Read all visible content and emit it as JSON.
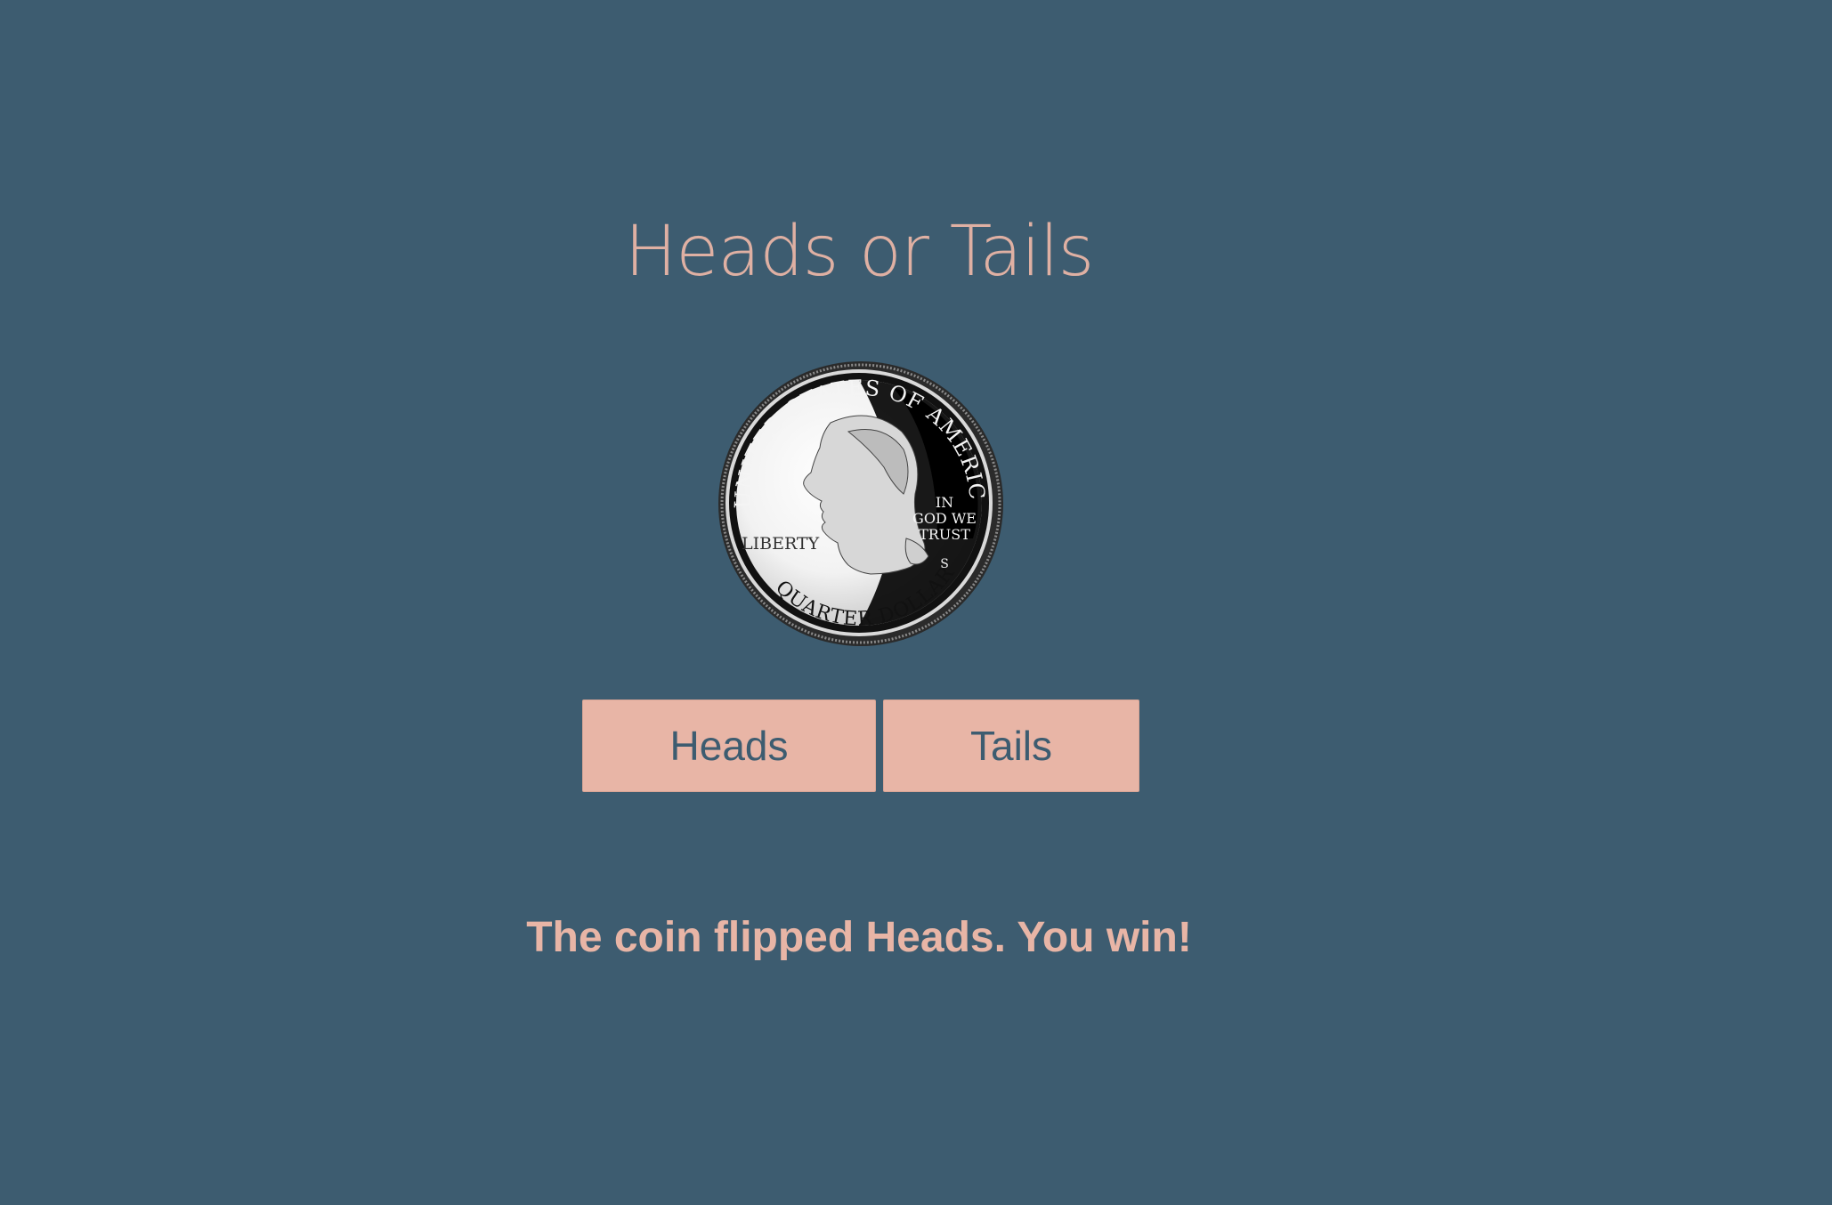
{
  "app": {
    "title": "Heads or Tails",
    "result": "The coin flipped Heads. You win!"
  },
  "coin": {
    "side": "heads",
    "top_text": "UNITED STATES OF AMERICA",
    "motto_line1": "IN",
    "motto_line2": "GOD WE",
    "motto_line3": "TRUST",
    "left_text": "LIBERTY",
    "bottom_text": "QUARTER DOLLAR",
    "mint_mark": "S"
  },
  "buttons": {
    "heads_label": "Heads",
    "tails_label": "Tails"
  },
  "colors": {
    "background": "#3d5c70",
    "accent": "#e8b5a6"
  }
}
